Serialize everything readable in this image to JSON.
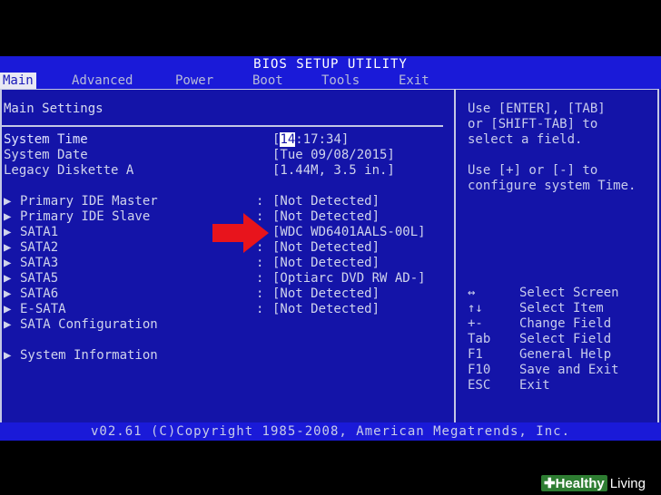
{
  "title": "BIOS SETUP UTILITY",
  "menu": {
    "items": [
      "Main",
      "Advanced",
      "Power",
      "Boot",
      "Tools",
      "Exit"
    ],
    "active": "Main"
  },
  "main": {
    "section_title": "Main Settings",
    "settings": [
      {
        "label": "System Time",
        "value": "[14:17:34]",
        "value_highlight": "14",
        "value_rest": ":17:34]"
      },
      {
        "label": "System Date",
        "value": "[Tue 09/08/2015]"
      },
      {
        "label": "Legacy Diskette A",
        "value": "[1.44M, 3.5 in.]"
      }
    ],
    "devices": [
      {
        "label": "Primary IDE Master",
        "sep": ":",
        "value": "[Not Detected]"
      },
      {
        "label": "Primary IDE Slave",
        "sep": ":",
        "value": "[Not Detected]"
      },
      {
        "label": "SATA1",
        "sep": ":",
        "value": "[WDC WD6401AALS-00L]"
      },
      {
        "label": "SATA2",
        "sep": ":",
        "value": "[Not Detected]"
      },
      {
        "label": "SATA3",
        "sep": ":",
        "value": "[Not Detected]"
      },
      {
        "label": "SATA5",
        "sep": ":",
        "value": "[Optiarc DVD RW AD-]"
      },
      {
        "label": "SATA6",
        "sep": ":",
        "value": "[Not Detected]"
      },
      {
        "label": "E-SATA",
        "sep": ":",
        "value": "[Not Detected]"
      },
      {
        "label": "SATA Configuration"
      }
    ],
    "system_info": "System Information",
    "submenu_marker": "▶"
  },
  "help": {
    "text1": [
      "Use [ENTER], [TAB]",
      "or [SHIFT-TAB] to",
      "select a field."
    ],
    "text2": [
      "Use [+] or [-] to",
      "configure system Time."
    ],
    "keys": [
      {
        "key": "↔",
        "desc": "Select Screen"
      },
      {
        "key": "↑↓",
        "desc": "Select Item"
      },
      {
        "key": "+-",
        "desc": "Change Field"
      },
      {
        "key": "Tab",
        "desc": "Select Field"
      },
      {
        "key": "F1",
        "desc": "General Help"
      },
      {
        "key": "F10",
        "desc": "Save and Exit"
      },
      {
        "key": "ESC",
        "desc": "Exit"
      }
    ]
  },
  "footer": "v02.61 (C)Copyright 1985-2008, American Megatrends, Inc.",
  "watermark": {
    "badge": "✚Healthy",
    "text": "Living"
  },
  "colors": {
    "background": "#1414a8",
    "highlight": "#ffffff",
    "text": "#d0d4ec",
    "arrow": "#e8141c"
  }
}
